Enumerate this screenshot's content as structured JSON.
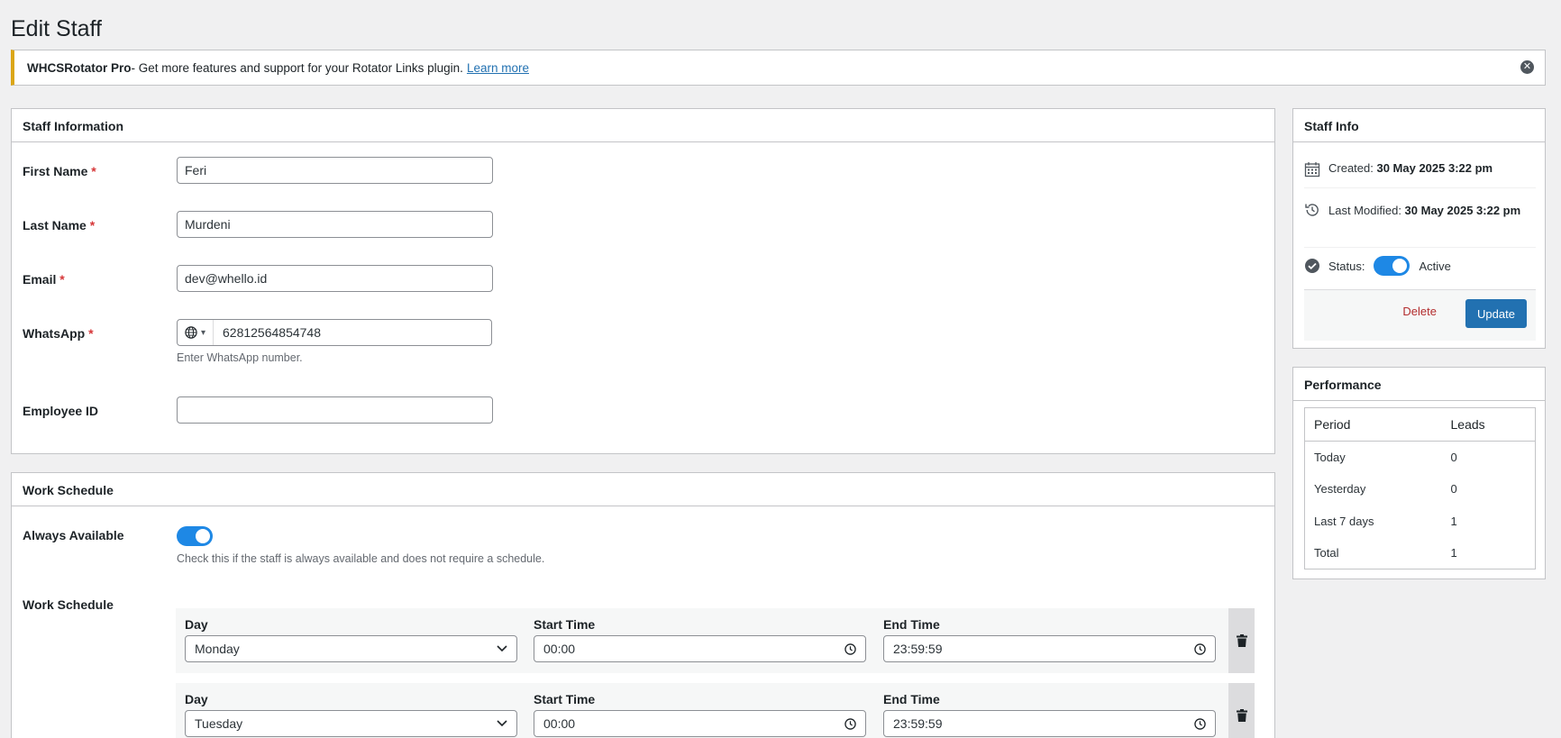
{
  "page": {
    "title": "Edit Staff"
  },
  "notice": {
    "brand": "WHCSRotator Pro",
    "text": " - Get more features and support for your Rotator Links plugin.",
    "link": "Learn more"
  },
  "staff_information": {
    "title": "Staff Information",
    "required_mark": "*",
    "first_name": {
      "label": "First Name",
      "value": "Feri"
    },
    "last_name": {
      "label": "Last Name",
      "value": "Murdeni"
    },
    "email": {
      "label": "Email",
      "value": "dev@whello.id"
    },
    "whatsapp": {
      "label": "WhatsApp",
      "value": "62812564854748",
      "help": "Enter WhatsApp number.",
      "flag_icon": "globe-icon"
    },
    "employee_id": {
      "label": "Employee ID",
      "value": ""
    }
  },
  "work_schedule": {
    "title": "Work Schedule",
    "always_available": {
      "label": "Always Available",
      "enabled": true,
      "help": "Check this if the staff is always available and does not require a schedule."
    },
    "schedule_label": "Work Schedule",
    "col_day": "Day",
    "col_start": "Start Time",
    "col_end": "End Time",
    "rows": [
      {
        "day": "Monday",
        "start": "00:00",
        "end": "23:59:59"
      },
      {
        "day": "Tuesday",
        "start": "00:00",
        "end": "23:59:59"
      }
    ]
  },
  "staff_info": {
    "title": "Staff Info",
    "created_label": "Created: ",
    "created_value": "30 May 2025 3:22 pm",
    "modified_label": "Last Modified: ",
    "modified_value": "30 May 2025 3:22 pm",
    "status_label": "Status:",
    "status_value": "Active",
    "delete_label": "Delete",
    "update_label": "Update"
  },
  "performance": {
    "title": "Performance",
    "headers": [
      "Period",
      "Leads"
    ],
    "rows": [
      {
        "period": "Today",
        "leads": "0"
      },
      {
        "period": "Yesterday",
        "leads": "0"
      },
      {
        "period": "Last 7 days",
        "leads": "1"
      },
      {
        "period": "Total",
        "leads": "1"
      }
    ]
  },
  "colors": {
    "accent": "#2271b1",
    "toggle": "#1e88e5",
    "danger": "#b32d2e",
    "notice_border": "#dba617"
  }
}
